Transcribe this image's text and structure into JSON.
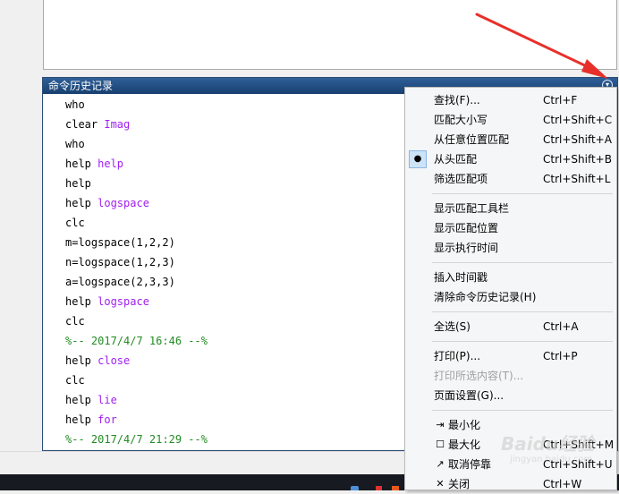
{
  "history": {
    "title": "命令历史记录",
    "options_icon": "chevron-down-circle-icon",
    "lines": [
      {
        "cmd": "who",
        "arg": "",
        "type": "cmd"
      },
      {
        "cmd": "clear ",
        "arg": "Imag",
        "type": "cmd"
      },
      {
        "cmd": "who",
        "arg": "",
        "type": "cmd"
      },
      {
        "cmd": "help ",
        "arg": "help",
        "type": "cmd"
      },
      {
        "cmd": "help",
        "arg": "",
        "type": "cmd"
      },
      {
        "cmd": "help ",
        "arg": "logspace",
        "type": "cmd"
      },
      {
        "cmd": "clc",
        "arg": "",
        "type": "cmd"
      },
      {
        "cmd": "m=logspace(1,2,2)",
        "arg": "",
        "type": "cmd"
      },
      {
        "cmd": "n=logspace(1,2,3)",
        "arg": "",
        "type": "cmd"
      },
      {
        "cmd": "a=logspace(2,3,3)",
        "arg": "",
        "type": "cmd"
      },
      {
        "cmd": "help ",
        "arg": "logspace",
        "type": "cmd"
      },
      {
        "cmd": "clc",
        "arg": "",
        "type": "cmd"
      },
      {
        "cmd": "%-- 2017/4/7 16:46 --%",
        "arg": "",
        "type": "sep"
      },
      {
        "cmd": "help ",
        "arg": "close",
        "type": "cmd"
      },
      {
        "cmd": "clc",
        "arg": "",
        "type": "cmd"
      },
      {
        "cmd": "help ",
        "arg": "lie",
        "type": "cmd"
      },
      {
        "cmd": "help ",
        "arg": "for",
        "type": "cmd"
      },
      {
        "cmd": "%-- 2017/4/7 21:29 --%",
        "arg": "",
        "type": "sep"
      }
    ]
  },
  "menu": {
    "groups": [
      [
        {
          "label": "查找(F)...",
          "shortcut": "Ctrl+F"
        },
        {
          "label": "匹配大小写",
          "shortcut": "Ctrl+Shift+C"
        },
        {
          "label": "从任意位置匹配",
          "shortcut": "Ctrl+Shift+A"
        },
        {
          "label": "从头匹配",
          "shortcut": "Ctrl+Shift+B",
          "checked": true
        },
        {
          "label": "筛选匹配项",
          "shortcut": "Ctrl+Shift+L"
        }
      ],
      [
        {
          "label": "显示匹配工具栏",
          "shortcut": ""
        },
        {
          "label": "显示匹配位置",
          "shortcut": ""
        },
        {
          "label": "显示执行时间",
          "shortcut": ""
        }
      ],
      [
        {
          "label": "插入时间戳",
          "shortcut": ""
        },
        {
          "label": "清除命令历史记录(H)",
          "shortcut": ""
        }
      ],
      [
        {
          "label": "全选(S)",
          "shortcut": "Ctrl+A"
        }
      ],
      [
        {
          "label": "打印(P)...",
          "shortcut": "Ctrl+P"
        },
        {
          "label": "打印所选内容(T)...",
          "shortcut": "",
          "disabled": true
        },
        {
          "label": "页面设置(G)...",
          "shortcut": ""
        }
      ],
      [
        {
          "label": "最小化",
          "shortcut": "",
          "icon": "minimize-icon"
        },
        {
          "label": "最大化",
          "shortcut": "Ctrl+Shift+M",
          "icon": "maximize-icon"
        },
        {
          "label": "取消停靠",
          "shortcut": "Ctrl+Shift+U",
          "icon": "undock-icon"
        },
        {
          "label": "关闭",
          "shortcut": "Ctrl+W",
          "icon": "close-icon"
        }
      ]
    ]
  },
  "watermark": {
    "text": "Baidu经验",
    "sub": "jingyan.baidu.com"
  },
  "colors": {
    "title_bar": "#17406f",
    "keyword_arg": "#a020f0",
    "separator": "#228b22",
    "arrow": "#e8302a",
    "checked_bg": "#cde3f7"
  }
}
